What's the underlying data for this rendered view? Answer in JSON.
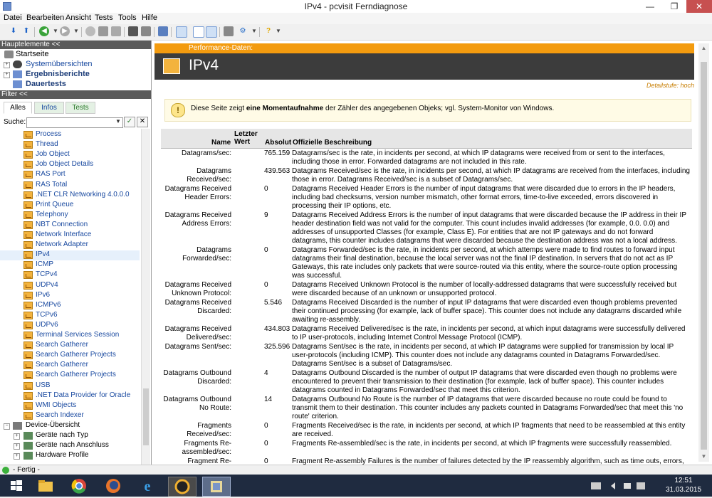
{
  "window": {
    "title": "IPv4 - pcvisit Ferndiagnose"
  },
  "menu": [
    "Datei",
    "Bearbeiten",
    "Ansicht",
    "Tests",
    "Tools",
    "Hilfe"
  ],
  "left_panel": {
    "header_main": "Hauptelemente <<",
    "main_items": [
      {
        "label": "Startseite"
      },
      {
        "label": "Systemübersichten"
      },
      {
        "label": "Ergebnisberichte"
      },
      {
        "label": "Dauertests"
      }
    ],
    "header_filter": "Filter <<",
    "tabs": [
      "Alles",
      "Infos",
      "Tests"
    ],
    "search_label": "Suche:",
    "search_value": "",
    "list_items": [
      "Process",
      "Thread",
      "Job Object",
      "Job Object Details",
      "RAS Port",
      "RAS Total",
      ".NET CLR Networking 4.0.0.0",
      "Print Queue",
      "Telephony",
      "NBT Connection",
      "Network Interface",
      "Network Adapter",
      "IPv4",
      "ICMP",
      "TCPv4",
      "UDPv4",
      "IPv6",
      "ICMPv6",
      "TCPv6",
      "UDPv6",
      "Terminal Services Session",
      "Search Gatherer",
      "Search Gatherer Projects",
      "Search Gatherer",
      "Search Gatherer Projects",
      "USB",
      ".NET Data Provider for Oracle",
      "WMI Objects",
      "Search Indexer"
    ],
    "device_header": "Device-Übersicht",
    "device_items": [
      "Geräte nach Typ",
      "Geräte nach Anschluss",
      "Hardware Profile"
    ]
  },
  "content": {
    "section_label": "Performance-Daten:",
    "page_title": "IPv4",
    "detail_level": "Detailstufe: hoch",
    "notice_pre": "Diese Seite zeigt ",
    "notice_bold": "eine Momentaufnahme",
    "notice_post": " der Zähler des angegebenen Objeks; vgl. System-Monitor von Windows.",
    "columns": {
      "name": "Name",
      "last": "Letzter Wert",
      "absolute": "Absolut",
      "description": "Offizielle Beschreibung"
    },
    "rows": [
      {
        "name": "Datagrams/sec:",
        "value": "765.159",
        "desc": "Datagrams/sec is the rate, in incidents per second, at which IP datagrams were received from or sent to the interfaces, including those in error. Forwarded datagrams are not included in this rate."
      },
      {
        "name": "Datagrams Received/sec:",
        "value": "439.563",
        "desc": "Datagrams Received/sec is the rate, in incidents per second, at which IP datagrams are received from the interfaces, including those in error. Datagrams Received/sec is a subset of Datagrams/sec."
      },
      {
        "name": "Datagrams Received Header Errors:",
        "value": "0",
        "desc": "Datagrams Received Header Errors is the number of input datagrams that were discarded due to errors in the IP headers, including bad checksums, version number mismatch, other format errors, time-to-live exceeded, errors discovered in processing their IP options, etc."
      },
      {
        "name": "Datagrams Received Address Errors:",
        "value": "9",
        "desc": "Datagrams Received Address Errors is the number of input datagrams that were discarded because the IP address in their IP header destination field was not valid for the computer. This count includes invalid addresses (for example, 0.0. 0.0) and addresses of unsupported Classes (for example, Class E). For entities that are not IP gateways and do not forward datagrams, this counter includes datagrams that were discarded because the destination address was not a local address."
      },
      {
        "name": "Datagrams Forwarded/sec:",
        "value": "0",
        "desc": "Datagrams Forwarded/sec is the rate, in incidents per second, at which attemps were made to find routes to forward input datagrams their final destination, because the local server was not the final IP destination. In servers that do not act as IP Gateways, this rate includes only packets that were source-routed via this entity, where the source-route option processing was successful."
      },
      {
        "name": "Datagrams Received Unknown Protocol:",
        "value": "0",
        "desc": "Datagrams Received Unknown Protocol is the number of locally-addressed datagrams that were successfully received but were discarded because of an unknown or unsupported protocol."
      },
      {
        "name": "Datagrams Received Discarded:",
        "value": "5.546",
        "desc": "Datagrams Received Discarded is the number of input IP datagrams that were discarded even though problems prevented their continued processing (for example, lack of buffer space). This counter does not include any datagrams discarded while awaiting re-assembly."
      },
      {
        "name": "Datagrams Received Delivered/sec:",
        "value": "434.803",
        "desc": "Datagrams Received Delivered/sec is the rate, in incidents per second, at which input datagrams were successfully delivered to IP user-protocols, including Internet Control Message Protocol (ICMP)."
      },
      {
        "name": "Datagrams Sent/sec:",
        "value": "325.596",
        "desc": "Datagrams Sent/sec is the rate, in incidents per second, at which IP datagrams were supplied for transmission by local IP user-protocols (including ICMP). This counter does not include any datagrams counted in Datagrams Forwarded/sec. Datagrams Sent/sec is a subset of Datagrams/sec."
      },
      {
        "name": "Datagrams Outbound Discarded:",
        "value": "4",
        "desc": "Datagrams Outbound Discarded is the number of output IP datagrams that were discarded even though no problems were encountered to prevent their transmission to their destination (for example, lack of buffer space). This counter includes datagrams counted in Datagrams Forwarded/sec that meet this criterion."
      },
      {
        "name": "Datagrams Outbound No Route:",
        "value": "14",
        "desc": "Datagrams Outbound No Route is the number of IP datagrams that were discarded because no route could be found to transmit them to their destination. This counter includes any packets counted in Datagrams Forwarded/sec that meet this 'no route' criterion."
      },
      {
        "name": "Fragments Received/sec:",
        "value": "0",
        "desc": "Fragments Received/sec is the rate, in incidents per second, at which IP fragments that need to be reassembled at this entity are received."
      },
      {
        "name": "Fragments Re-assembled/sec:",
        "value": "0",
        "desc": "Fragments Re-assembled/sec is the rate, in incidents per second, at which IP fragments were successfully reassembled."
      },
      {
        "name": "Fragment Re-",
        "value": "0",
        "desc": "Fragment Re-assembly Failures is the number of failures detected by the IP reassembly algorithm, such as time outs, errors, etc."
      }
    ]
  },
  "status": {
    "text": "- Fertig -"
  },
  "taskbar": {
    "time": "12:51",
    "date": "31.03.2015"
  }
}
